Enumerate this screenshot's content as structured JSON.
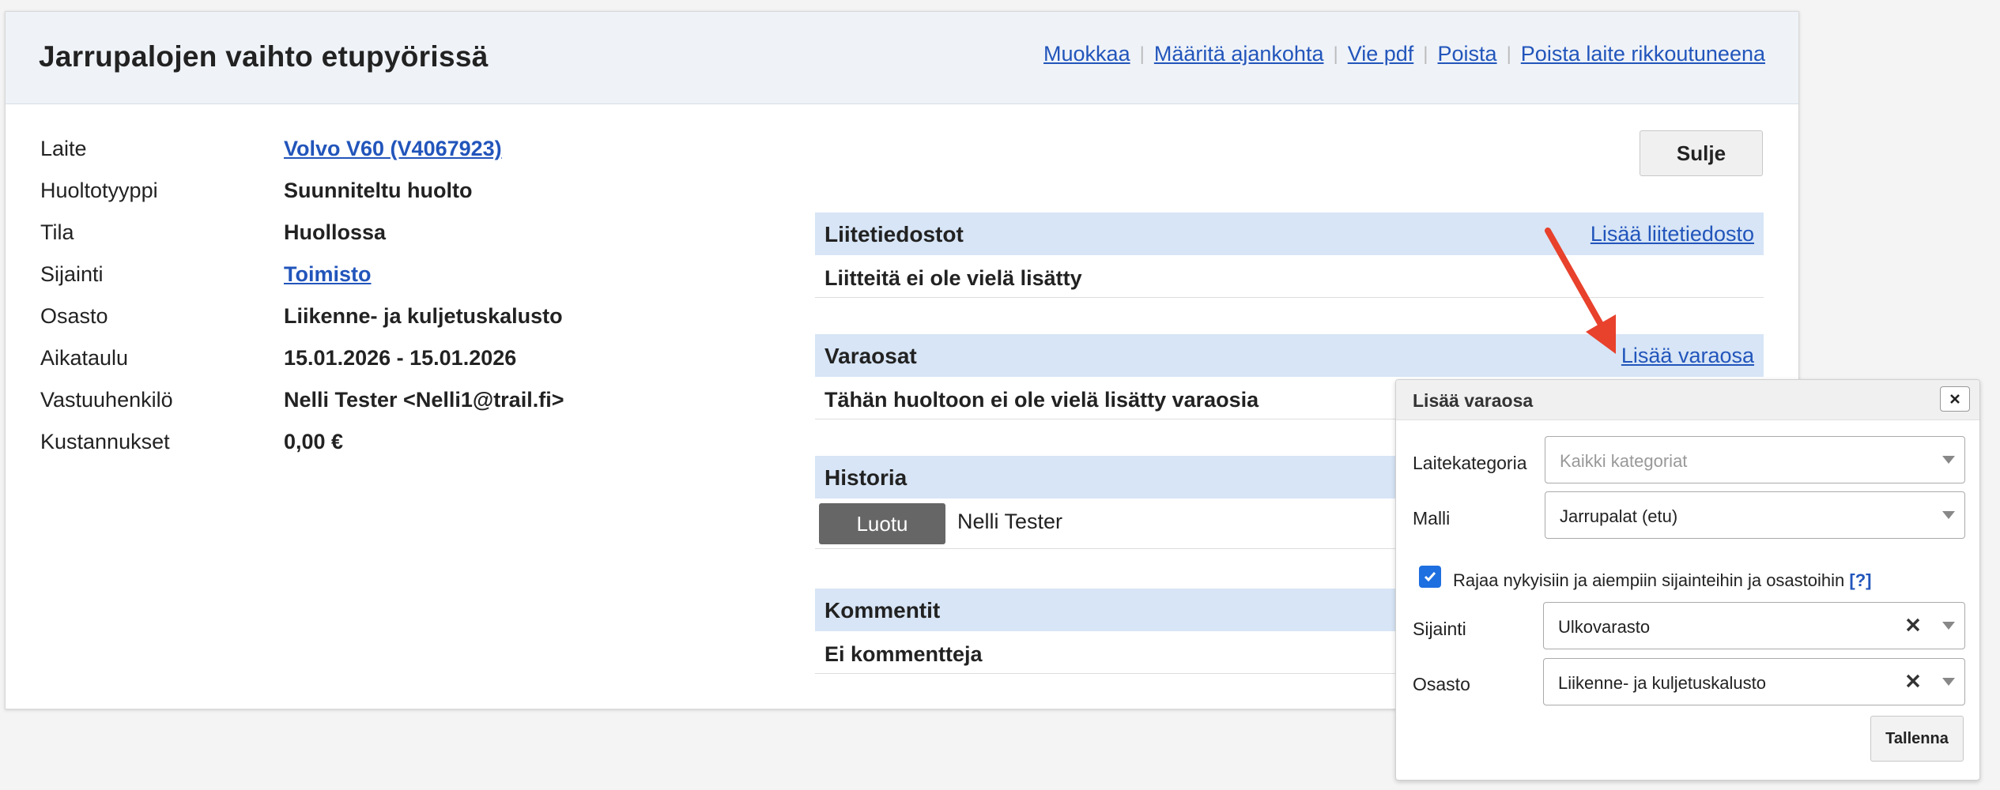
{
  "page": {
    "title": "Jarrupalojen vaihto etupyörissä",
    "top_links": [
      "Muokkaa",
      "Määritä ajankohta",
      "Vie pdf",
      "Poista",
      "Poista laite rikkoutuneena"
    ]
  },
  "info": {
    "rows": [
      {
        "label": "Laite",
        "value": "Volvo V60 (V4067923)"
      },
      {
        "label": "Huoltotyyppi",
        "value": "Suunniteltu huolto"
      },
      {
        "label": "Tila",
        "value": "Huollossa"
      },
      {
        "label": "Sijainti",
        "value": "Toimisto"
      },
      {
        "label": "Osasto",
        "value": "Liikenne- ja kuljetuskalusto"
      },
      {
        "label": "Aikataulu",
        "value": "15.01.2026 - 15.01.2026"
      },
      {
        "label": "Vastuuhenkilö",
        "value": "Nelli Tester <Nelli1@trail.fi>"
      },
      {
        "label": "Kustannukset",
        "value": "0,00 €"
      }
    ]
  },
  "close_label": "Sulje",
  "sections": {
    "attachments": {
      "title": "Liitetiedostot",
      "link": "Lisää liitetiedosto",
      "text": "Liitteitä ei ole vielä lisätty"
    },
    "parts": {
      "title": "Varaosat",
      "link": "Lisää varaosa",
      "text": "Tähän huoltoon ei ole vielä lisätty varaosia"
    },
    "history": {
      "title": "Historia",
      "badge": "Luotu",
      "user": "Nelli Tester"
    },
    "comments": {
      "title": "Kommentit",
      "text": "Ei kommentteja"
    }
  },
  "popup": {
    "title": "Lisää varaosa",
    "category_label": "Laitekategoria",
    "category_placeholder": "Kaikki kategoriat",
    "model_label": "Malli",
    "model_value": "Jarrupalat (etu)",
    "restrict_label": "Rajaa nykyisiin ja aiempiin sijainteihin ja osastoihin",
    "restrict_checked": true,
    "help_link": "[?]",
    "location_label": "Sijainti",
    "location_value": "Ulkovarasto",
    "department_label": "Osasto",
    "department_value": "Liikenne- ja kuljetuskalusto",
    "save_label": "Tallenna"
  },
  "colors": {
    "link": "#2255bb",
    "section_header_bg": "#d7e5f6",
    "annotation_arrow": "#e8412c",
    "checkbox": "#1e6fe0"
  }
}
